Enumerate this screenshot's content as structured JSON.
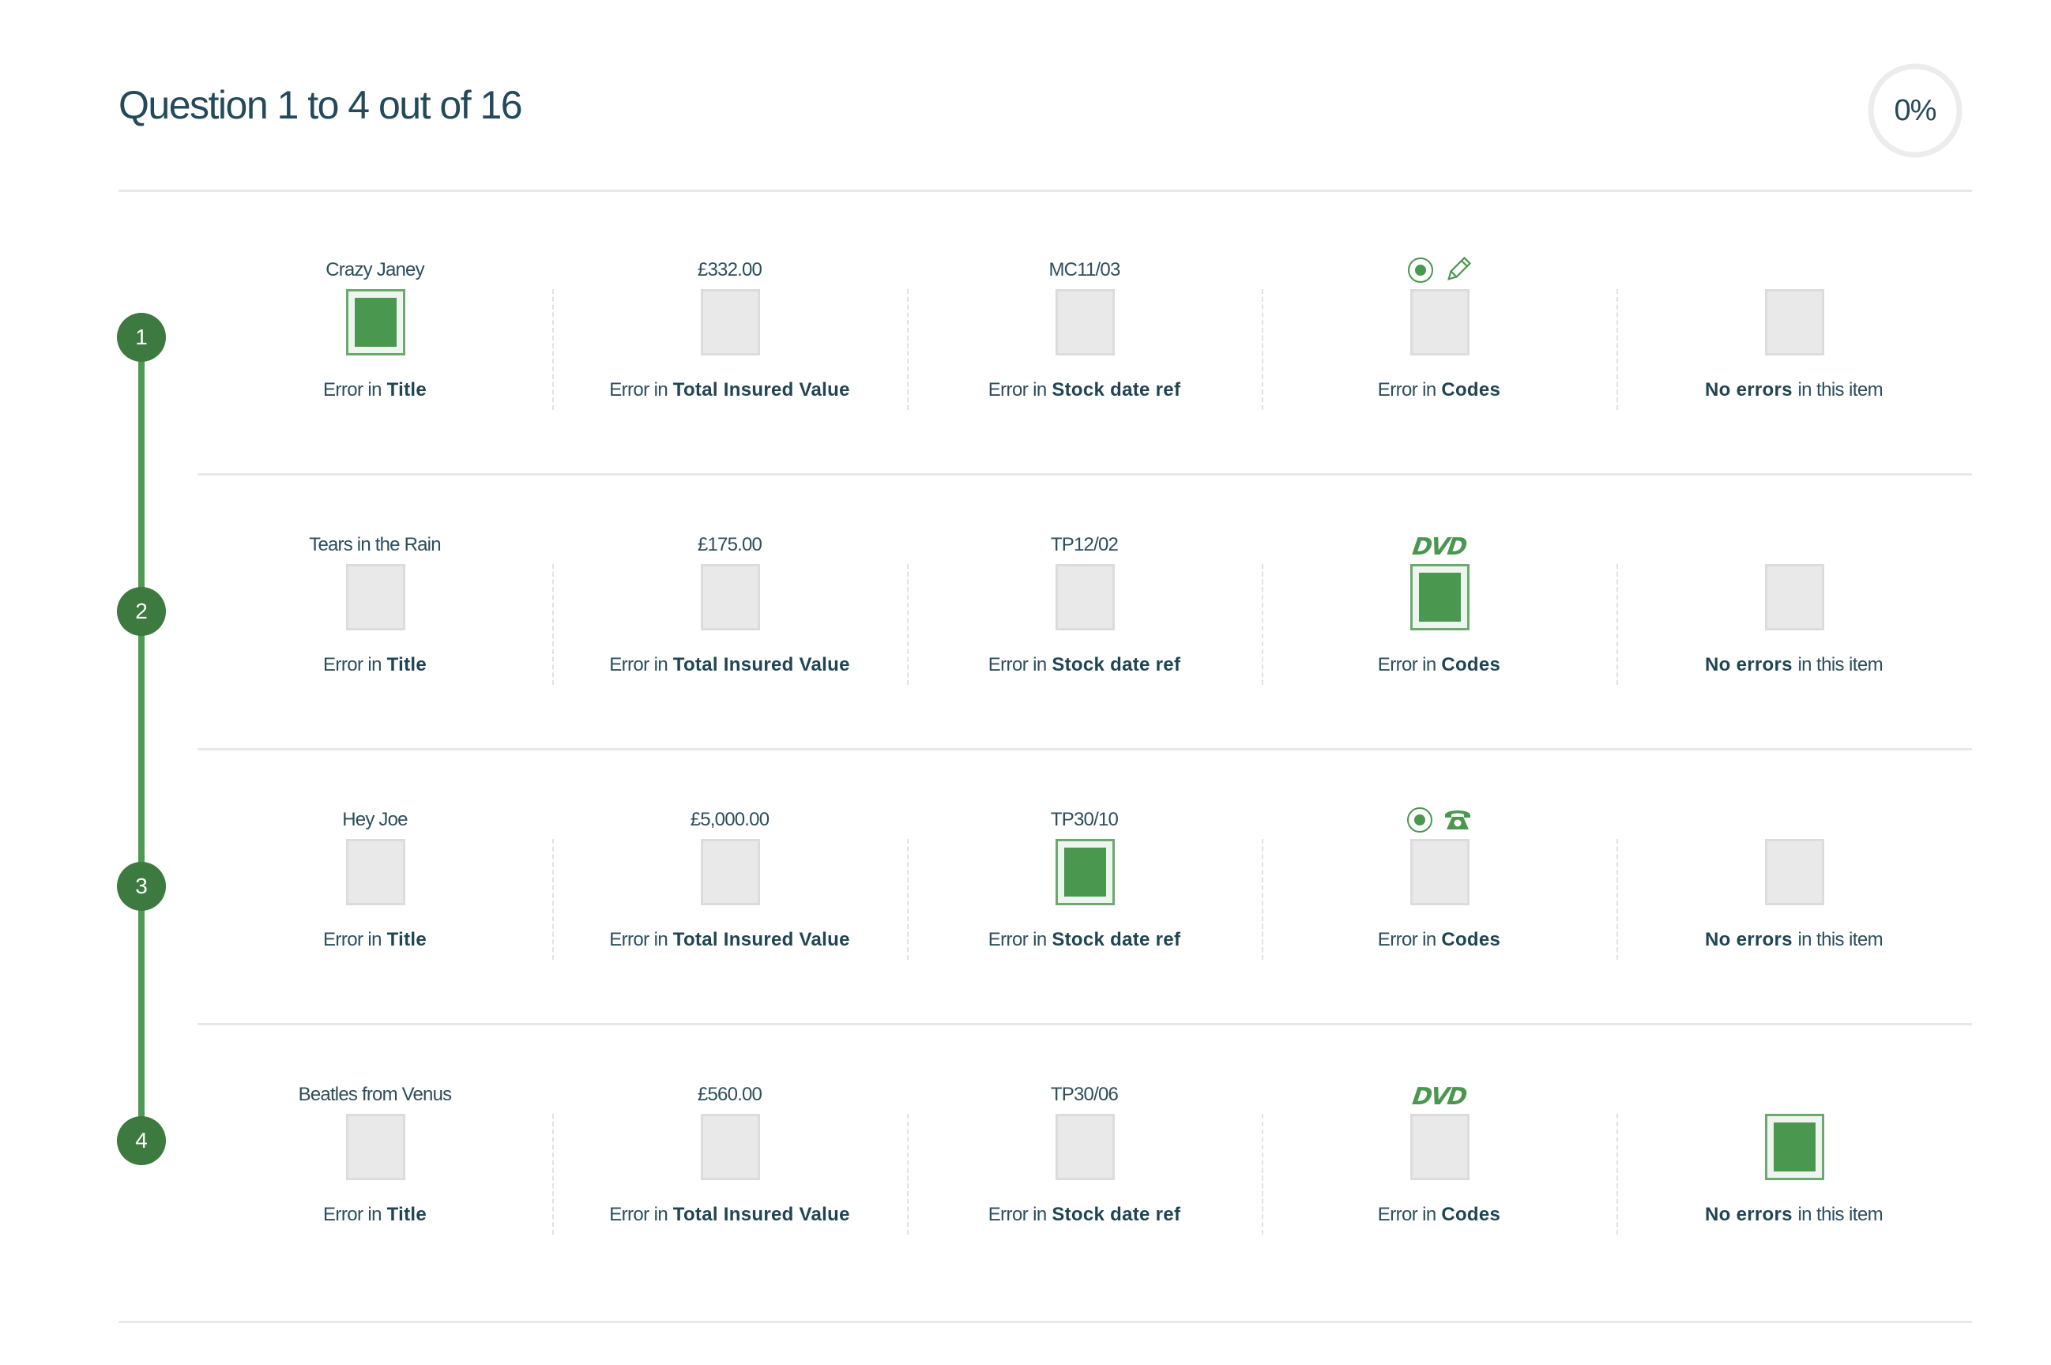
{
  "header": {
    "title": "Question 1 to 4 out of 16",
    "progress_percent": 0,
    "progress_label": "0%"
  },
  "colors": {
    "accent": "#4a974f",
    "step_fill": "#3c7a40",
    "timeline": "#4e9a52",
    "text": "#23495a",
    "unchecked_box": "#e9e9e9",
    "divider": "#e8e8e8"
  },
  "columns": [
    {
      "prefix": "Error in",
      "bold": "Title",
      "suffix": ""
    },
    {
      "prefix": "Error in",
      "bold": "Total Insured Value",
      "suffix": ""
    },
    {
      "prefix": "Error in",
      "bold": "Stock date ref",
      "suffix": ""
    },
    {
      "prefix": "Error in",
      "bold": "Codes",
      "suffix": ""
    },
    {
      "prefix": "",
      "bold": "No errors",
      "suffix": "in this item"
    }
  ],
  "questions": [
    {
      "number": "1",
      "title": "Crazy Janey",
      "value": "£332.00",
      "stock_ref": "MC11/03",
      "code_icons": [
        "radio-selected-icon",
        "pencil-icon"
      ],
      "selected": 0
    },
    {
      "number": "2",
      "title": "Tears in the Rain",
      "value": "£175.00",
      "stock_ref": "TP12/02",
      "code_icons": [
        "dvd-icon"
      ],
      "code_text": "DVD",
      "selected": 3
    },
    {
      "number": "3",
      "title": "Hey Joe",
      "value": "£5,000.00",
      "stock_ref": "TP30/10",
      "code_icons": [
        "radio-selected-icon",
        "telephone-icon"
      ],
      "selected": 2
    },
    {
      "number": "4",
      "title": "Beatles from Venus",
      "value": "£560.00",
      "stock_ref": "TP30/06",
      "code_icons": [
        "dvd-icon"
      ],
      "code_text": "DVD",
      "selected": 4
    }
  ]
}
